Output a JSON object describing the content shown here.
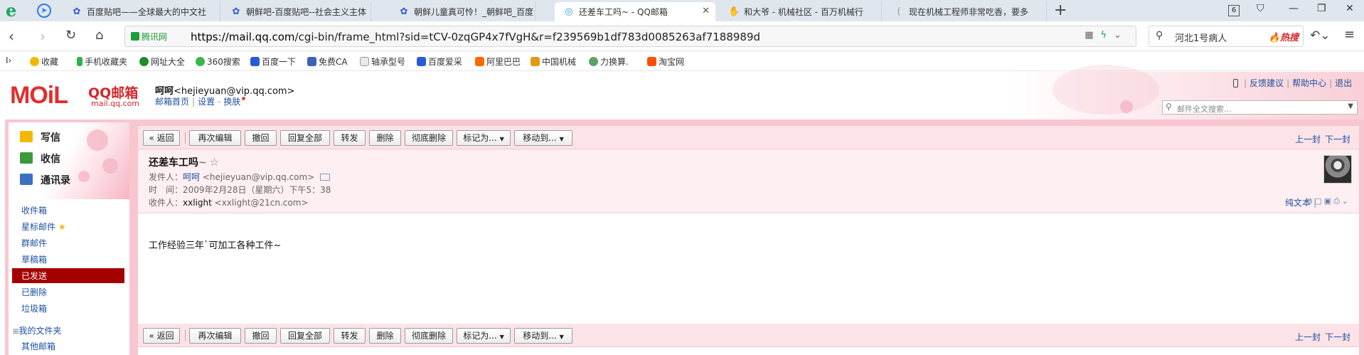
{
  "browser": {
    "tabs": [
      {
        "title": "百度贴吧——全球最大的中文社",
        "icon": "baidu-paw-icon"
      },
      {
        "title": "朝鲜吧-百度贴吧--社会主义主体",
        "icon": "baidu-paw-icon"
      },
      {
        "title": "朝鲜儿童真可怜！_朝鲜吧_百度",
        "icon": "baidu-paw-icon"
      },
      {
        "title": "还差车工吗~ - QQ邮箱",
        "icon": "qqmail-icon",
        "active": true
      },
      {
        "title": "和大爷 - 机械社区 - 百万机械行",
        "icon": "handshake-icon"
      },
      {
        "title": "现在机械工程师非常吃香，要多",
        "icon": "loading-icon"
      }
    ],
    "tab_count": "6",
    "secure_label": "腾讯网",
    "url_host": "https://mail.qq.com",
    "url_path": "/cgi-bin/frame_html?sid=tCV-0zqGP4x7fVgH&r=f239569b1df783d0085263af7188989d",
    "search_query": "河北1号病人",
    "search_hot": "热搜",
    "bookmarks": [
      "收藏",
      "手机收藏夹",
      "网址大全",
      "360搜索",
      "百度一下",
      "免费CA",
      "轴承型号",
      "百度爱采",
      "阿里巴巴",
      "中国机械",
      "力换算.",
      "淘宝网"
    ]
  },
  "mail": {
    "logo": {
      "brand_main": "MOiL",
      "brand_cn": "QQ邮箱",
      "brand_domain": "mail.qq.com"
    },
    "user": {
      "name": "呵呵",
      "email": "<hejieyuan@vip.qq.com>"
    },
    "user_links": [
      "邮箱首页",
      "设置",
      "换肤"
    ],
    "top_links": [
      "反馈建议",
      "帮助中心",
      "退出"
    ],
    "fulltext_placeholder": "邮件全文搜索...",
    "sidebar": {
      "main_actions": [
        {
          "label": "写信",
          "icon": "compose-icon"
        },
        {
          "label": "收信",
          "icon": "inbox-download-icon"
        },
        {
          "label": "通讯录",
          "icon": "contacts-icon"
        }
      ],
      "folders": [
        "收件箱",
        "星标邮件",
        "群邮件",
        "草稿箱",
        "已发送",
        "已删除",
        "垃圾箱"
      ],
      "active_folder": "已发送",
      "my_folders": "我的文件夹",
      "other_mailboxes": "其他邮箱"
    },
    "toolbar": {
      "back": "« 返回",
      "buttons": [
        "再次编辑",
        "撤回",
        "回复全部",
        "转发",
        "删除",
        "彻底删除",
        "标记为...",
        "移动到..."
      ],
      "prev": "上一封",
      "next": "下一封"
    },
    "message": {
      "subject": "还差车工吗",
      "subject_suffix": "~",
      "from_label": "发件人：",
      "from_name": "呵呵",
      "from_email": "<hejieyuan@vip.qq.com>",
      "time_label": "时　间：",
      "time_value": "2009年2月28日（星期六）下午5：38",
      "to_label": "收件人：",
      "to_name": "xxlight",
      "to_email": "<xxlight@21cn.com>",
      "plain_text": "纯文本",
      "body": "工作经验三年`可加工各种工件~"
    }
  }
}
